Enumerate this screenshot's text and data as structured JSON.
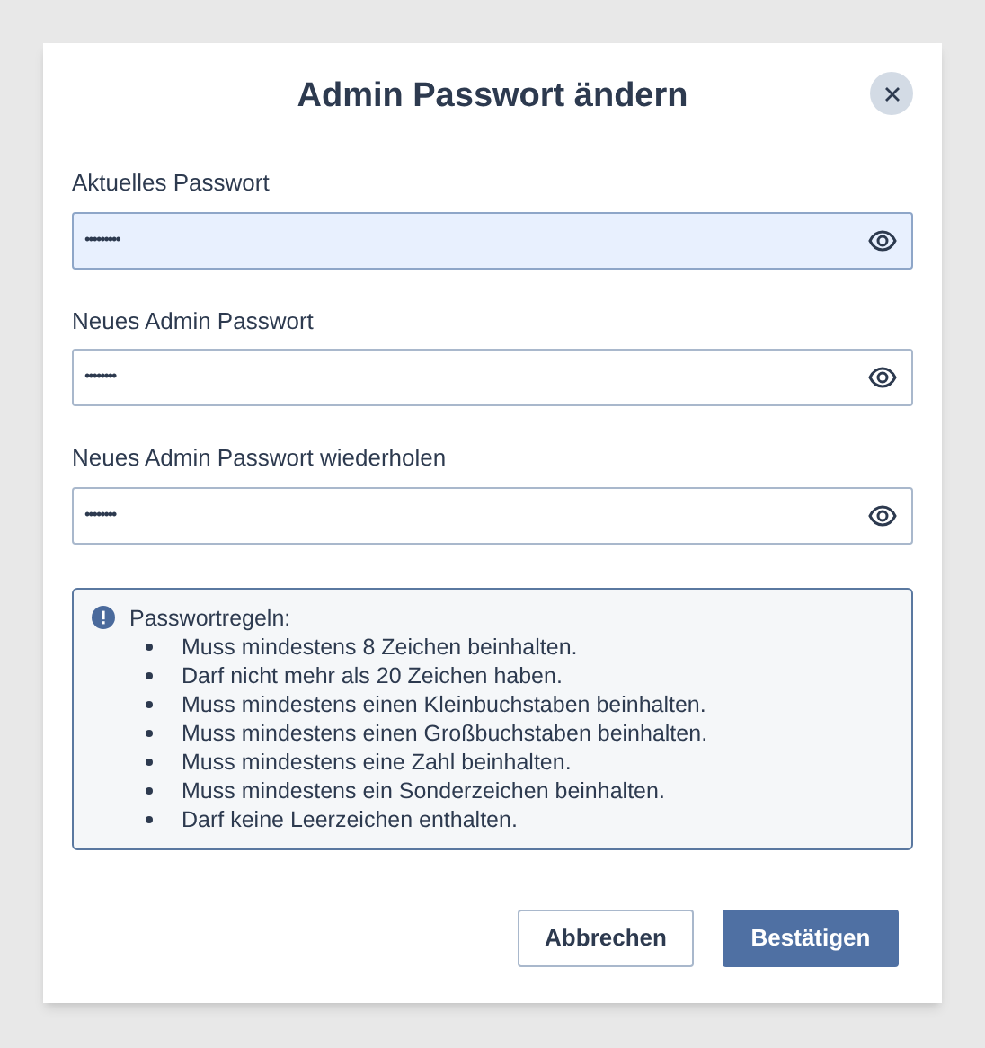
{
  "dialog": {
    "title": "Admin Passwort ändern",
    "fields": [
      {
        "label": "Aktuelles Passwort",
        "value": "•••••••••",
        "focused": true
      },
      {
        "label": "Neues Admin Passwort",
        "value": "••••••••",
        "focused": false
      },
      {
        "label": "Neues Admin Passwort wiederholen",
        "value": "••••••••",
        "focused": false
      }
    ],
    "rules": {
      "title": "Passwortregeln:",
      "items": [
        "Muss mindestens 8 Zeichen beinhalten.",
        "Darf nicht mehr als 20 Zeichen haben.",
        "Muss mindestens einen Kleinbuchstaben beinhalten.",
        "Muss mindestens einen Großbuchstaben beinhalten.",
        "Muss mindestens eine Zahl beinhalten.",
        "Muss mindestens ein Sonderzeichen beinhalten.",
        "Darf keine Leerzeichen enthalten."
      ]
    },
    "buttons": [
      {
        "label": "Abbrechen",
        "kind": "secondary"
      },
      {
        "label": "Bestätigen",
        "kind": "primary"
      }
    ]
  }
}
